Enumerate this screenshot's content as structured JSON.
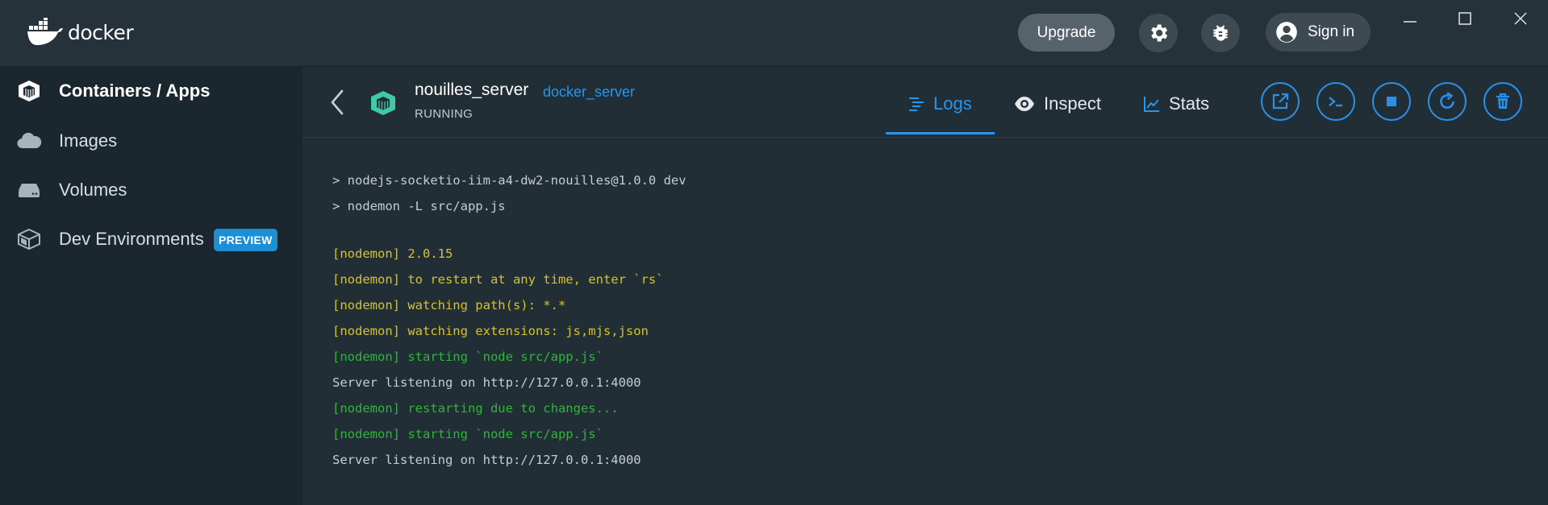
{
  "header": {
    "logo_text": "docker",
    "upgrade_label": "Upgrade",
    "signin_label": "Sign in",
    "icons": [
      "gear-icon",
      "bug-icon",
      "account-icon"
    ]
  },
  "sidebar": {
    "items": [
      {
        "label": "Containers / Apps",
        "icon": "container-icon",
        "active": true
      },
      {
        "label": "Images",
        "icon": "cloud-icon",
        "active": false
      },
      {
        "label": "Volumes",
        "icon": "drive-icon",
        "active": false
      },
      {
        "label": "Dev Environments",
        "icon": "box-icon",
        "active": false,
        "badge": "PREVIEW"
      }
    ]
  },
  "container": {
    "name": "nouilles_server",
    "image": "docker_server",
    "status": "RUNNING"
  },
  "tabs": [
    {
      "label": "Logs",
      "icon": "logs-icon",
      "active": true
    },
    {
      "label": "Inspect",
      "icon": "eye-icon",
      "active": false
    },
    {
      "label": "Stats",
      "icon": "chart-icon",
      "active": false
    }
  ],
  "actions": [
    "open-browser-icon",
    "cli-icon",
    "stop-icon",
    "restart-icon",
    "delete-icon"
  ],
  "logs": [
    {
      "text": "> nodejs-socketio-iim-a4-dw2-nouilles@1.0.0 dev",
      "color": "default"
    },
    {
      "text": "> nodemon -L src/app.js",
      "color": "default"
    },
    {
      "text": "[nodemon] 2.0.15",
      "color": "yellow"
    },
    {
      "text": "[nodemon] to restart at any time, enter `rs`",
      "color": "yellow"
    },
    {
      "text": "[nodemon] watching path(s): *.*",
      "color": "yellow"
    },
    {
      "text": "[nodemon] watching extensions: js,mjs,json",
      "color": "yellow"
    },
    {
      "text": "[nodemon] starting `node src/app.js`",
      "color": "green"
    },
    {
      "text": "Server listening on http://127.0.0.1:4000",
      "color": "default"
    },
    {
      "text": "[nodemon] restarting due to changes...",
      "color": "green"
    },
    {
      "text": "[nodemon] starting `node src/app.js`",
      "color": "green"
    },
    {
      "text": "Server listening on http://127.0.0.1:4000",
      "color": "default"
    }
  ],
  "colors": {
    "accent": "#2496ed",
    "log_yellow": "#d6c22a",
    "log_green": "#2fb53b",
    "container_icon": "#3ec9a7"
  }
}
